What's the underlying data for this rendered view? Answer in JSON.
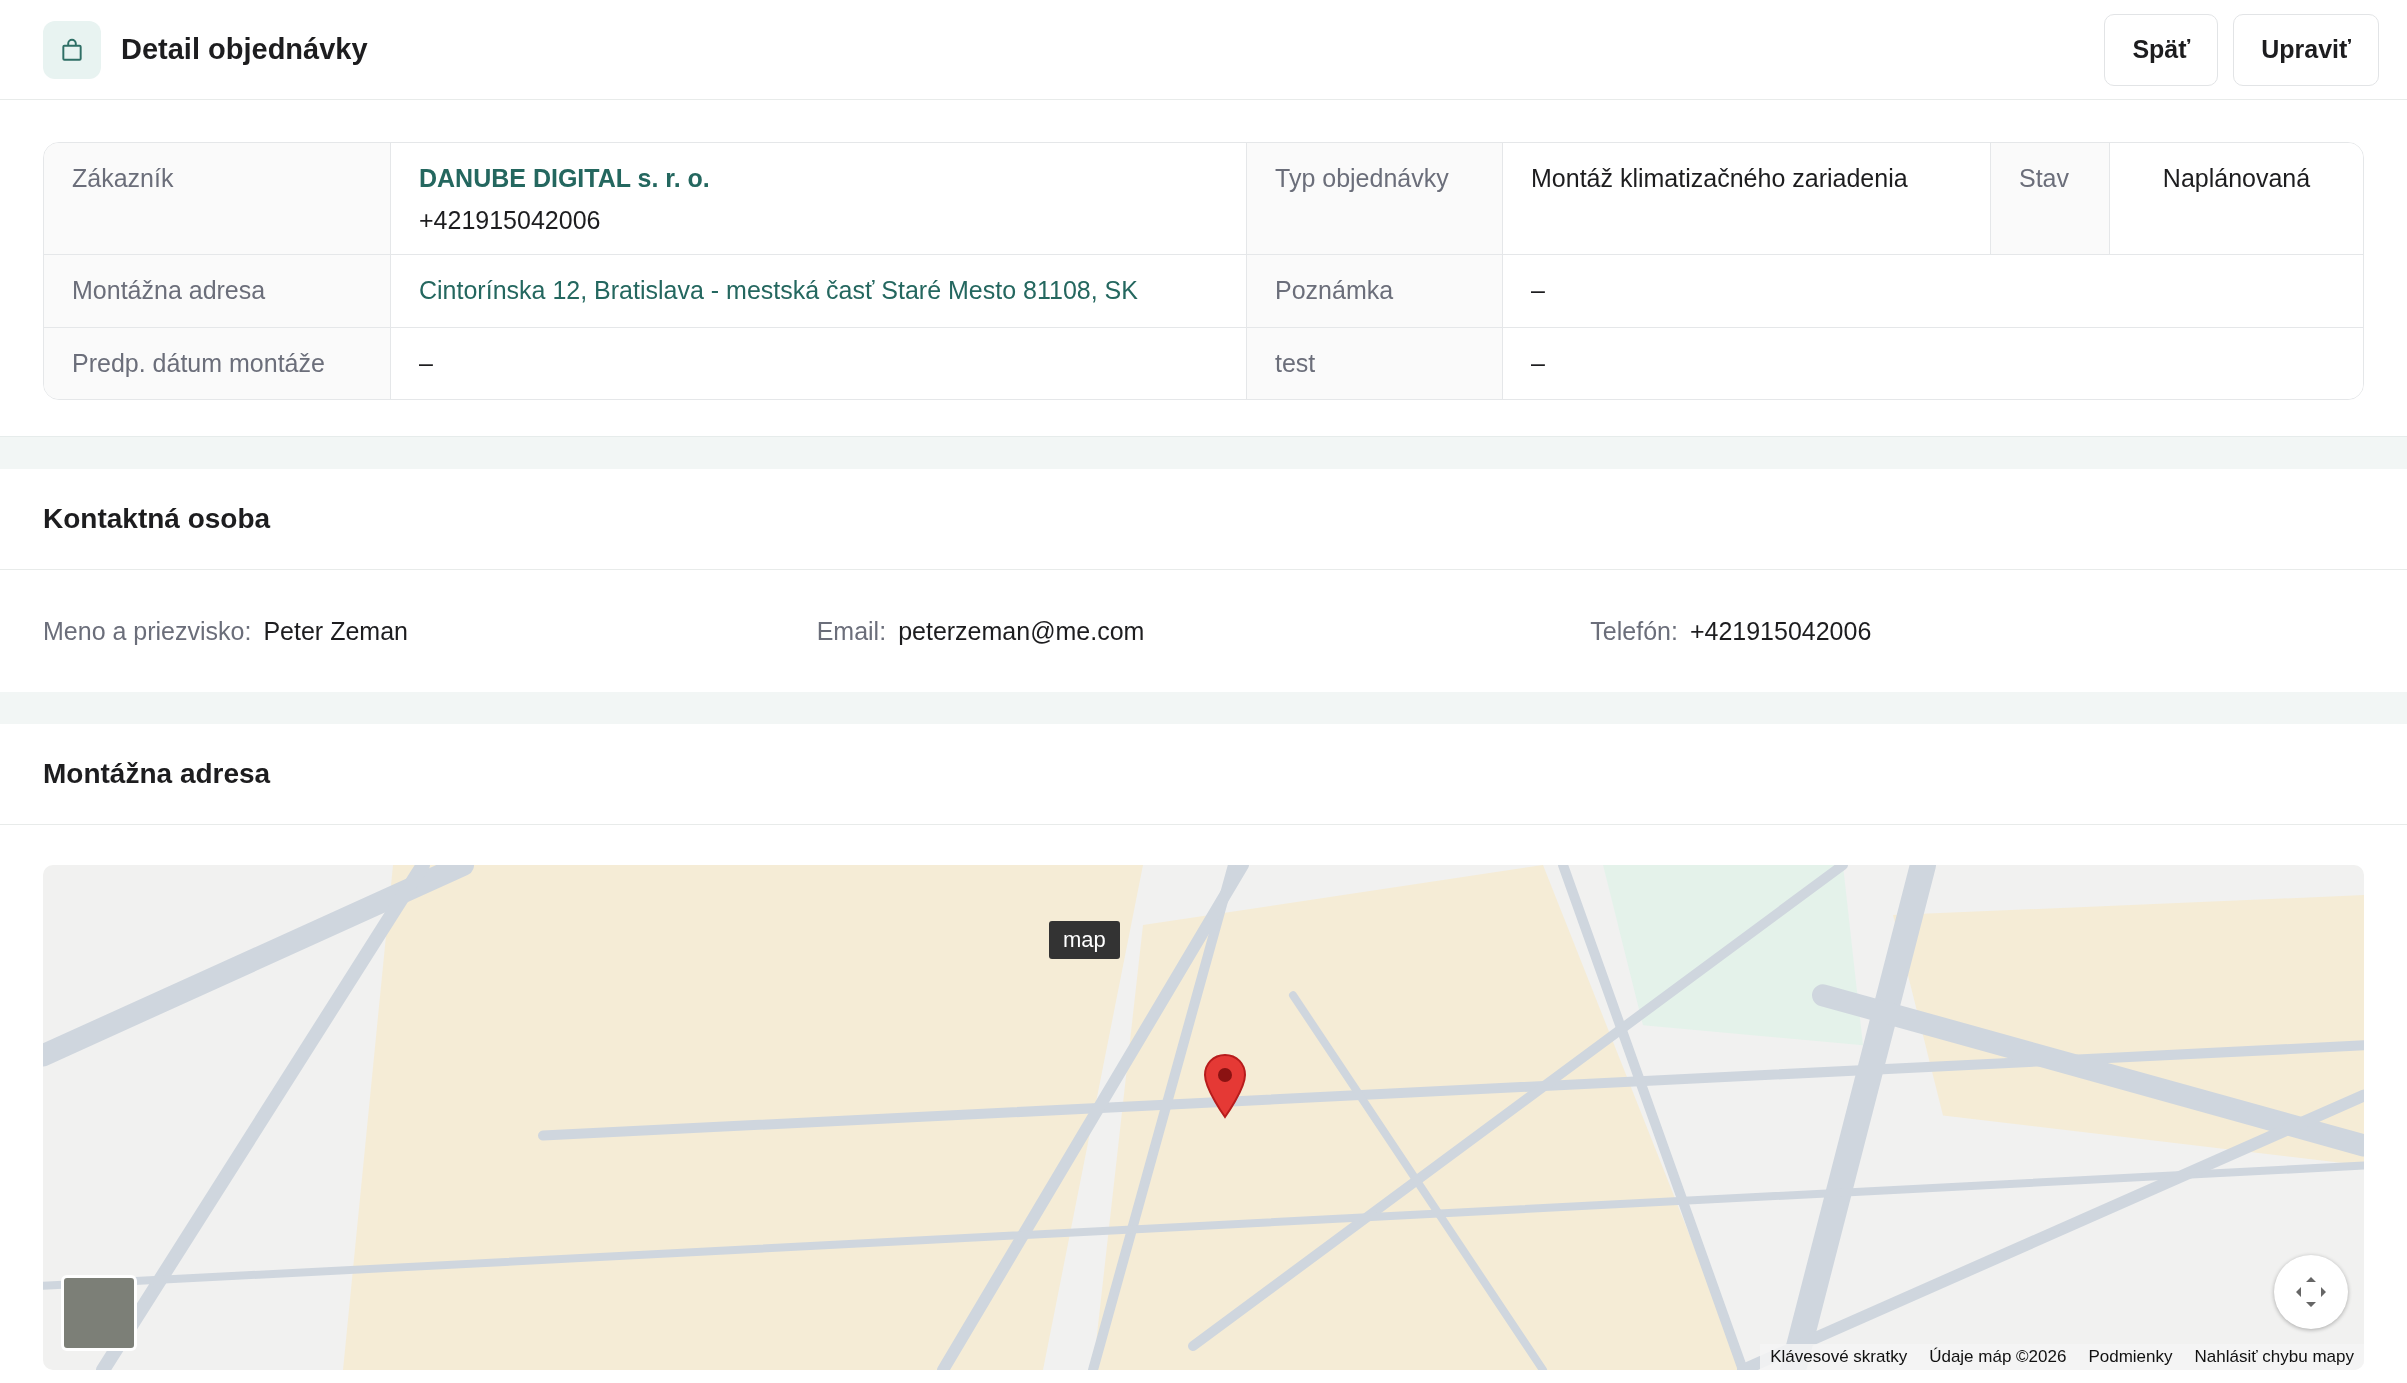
{
  "header": {
    "title": "Detail objednávky",
    "buttons": [
      "Späť",
      "Upraviť"
    ]
  },
  "order_details": {
    "customer": {
      "label": "Zákazník",
      "name": "DANUBE DIGITAL s. r. o.",
      "phone": "+421915042006"
    },
    "order_type": {
      "label": "Typ objednávky",
      "value": "Montáž klimatizačného zariadenia"
    },
    "status": {
      "label": "Stav",
      "value": "Naplánovaná"
    },
    "address": {
      "label": "Montážna adresa",
      "value": "Cintorínska 12, Bratislava - mestská časť Staré Mesto 81108, SK"
    },
    "note": {
      "label": "Poznámka",
      "value": "–"
    },
    "date": {
      "label": "Predp. dátum montáže",
      "value": "–"
    },
    "extra": {
      "label": "test",
      "value": "–"
    }
  },
  "contact": {
    "title": "Kontaktná osoba",
    "fields": [
      {
        "label": "Meno a priezvisko:",
        "value": "Peter Zeman"
      },
      {
        "label": "Email:",
        "value": "peterzeman@me.com"
      },
      {
        "label": "Telefón:",
        "value": "+421915042006"
      }
    ]
  },
  "installation_address": {
    "title": "Montážna adresa",
    "map": {
      "tooltip": "map",
      "footer_links": [
        "Klávesové skratky",
        "Údaje máp ©2026",
        "Podmienky",
        "Nahlásiť chybu mapy"
      ]
    }
  }
}
